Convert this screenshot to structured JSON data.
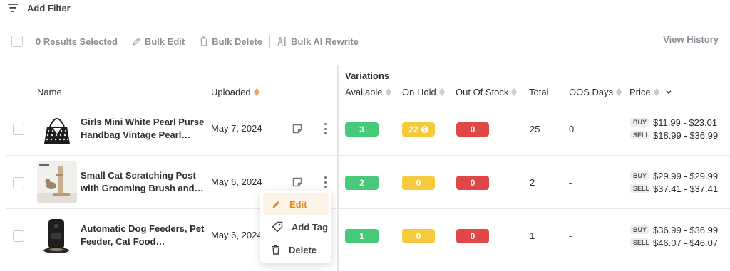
{
  "filter": {
    "label": "Add Filter",
    "icon": "filter-icon"
  },
  "bulk": {
    "selected": "0 Results Selected",
    "edit": "Bulk Edit",
    "delete": "Bulk Delete",
    "ai_rewrite": "Bulk AI Rewrite",
    "history": "View History"
  },
  "columns": {
    "name": "Name",
    "uploaded": "Uploaded",
    "variations": "Variations",
    "available": "Available",
    "on_hold": "On Hold",
    "out_of_stock": "Out Of Stock",
    "total": "Total",
    "oos_days": "OOS Days",
    "price": "Price"
  },
  "price_labels": {
    "buy": "BUY",
    "sell": "SELL"
  },
  "rows": [
    {
      "name": "Girls Mini White Pearl Purse Handbag Vintage Pearl…",
      "uploaded": "May 7, 2024",
      "available": "3",
      "on_hold": "22",
      "out_of_stock": "0",
      "total": "25",
      "oos_days": "0",
      "buy": "$11.99 - $23.01",
      "sell": "$18.99 - $36.99"
    },
    {
      "name": "Small Cat Scratching Post with Grooming Brush and…",
      "uploaded": "May 6, 2024",
      "available": "2",
      "on_hold": "0",
      "out_of_stock": "0",
      "total": "2",
      "oos_days": "-",
      "buy": "$29.99 - $29.99",
      "sell": "$37.41 - $37.41"
    },
    {
      "name": "Automatic Dog Feeders, Pet Feeder, Cat Food…",
      "uploaded": "May 6, 2024",
      "available": "1",
      "on_hold": "0",
      "out_of_stock": "0",
      "total": "1",
      "oos_days": "-",
      "buy": "$36.99 - $36.99",
      "sell": "$46.07 - $46.07"
    }
  ],
  "context_menu": {
    "edit": "Edit",
    "add_tag": "Add Tag",
    "delete": "Delete"
  },
  "colors": {
    "available": "#47c97a",
    "on_hold": "#f6ca3d",
    "out_of_stock": "#e04848",
    "accent": "#e08a2e"
  }
}
